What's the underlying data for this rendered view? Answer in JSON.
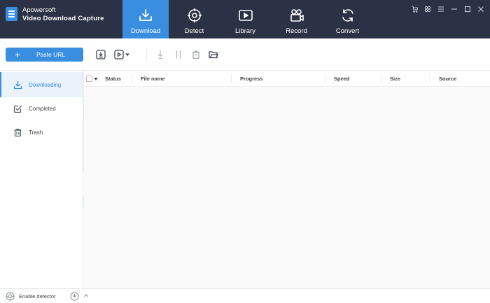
{
  "app": {
    "brand_line1": "Apowersoft",
    "brand_line2": "Video Download Capture",
    "accent_color": "#3a8ee0",
    "header_color": "#2b3245"
  },
  "nav": [
    {
      "label": "Download",
      "icon": "download-icon",
      "active": true
    },
    {
      "label": "Detect",
      "icon": "detect-icon",
      "active": false
    },
    {
      "label": "Library",
      "icon": "library-icon",
      "active": false
    },
    {
      "label": "Record",
      "icon": "record-icon",
      "active": false
    },
    {
      "label": "Convert",
      "icon": "convert-icon",
      "active": false
    }
  ],
  "window_controls": [
    "cart-icon",
    "grid-icon",
    "menu-icon",
    "minimize-icon",
    "maximize-icon",
    "close-icon"
  ],
  "toolbar": {
    "paste_label": "Paste URL",
    "icons": [
      "download-task-icon",
      "video-task-icon",
      "caret-down-icon",
      "start-icon",
      "pause-icon",
      "delete-icon",
      "folder-icon"
    ]
  },
  "sidebar": {
    "items": [
      {
        "label": "Downloading",
        "icon": "download-icon",
        "active": true
      },
      {
        "label": "Completed",
        "icon": "completed-icon",
        "active": false
      },
      {
        "label": "Trash",
        "icon": "trash-icon",
        "active": false
      }
    ]
  },
  "table": {
    "columns": [
      "Status",
      "File name",
      "Progress",
      "Speed",
      "Size",
      "Source"
    ],
    "rows": []
  },
  "statusbar": {
    "detector_label": "Enable detector"
  }
}
